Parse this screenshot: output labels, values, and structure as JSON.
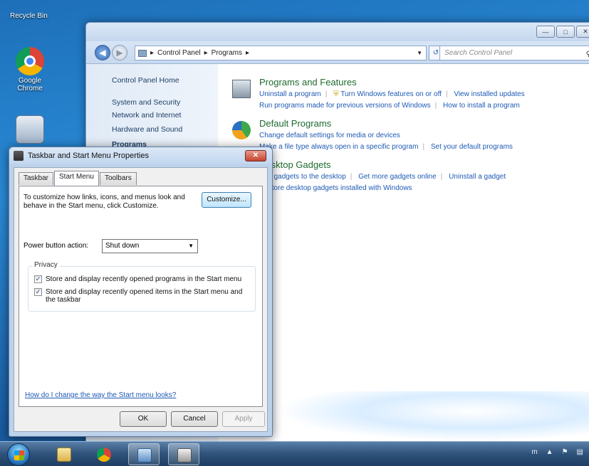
{
  "desktop": {
    "recycle_bin": "Recycle Bin",
    "chrome": "Google Chrome"
  },
  "control_panel": {
    "breadcrumb": [
      "Control Panel",
      "Programs"
    ],
    "search_placeholder": "Search Control Panel",
    "sidebar": [
      "Control Panel Home",
      "System and Security",
      "Network and Internet",
      "Hardware and Sound",
      "Programs"
    ],
    "categories": [
      {
        "title": "Programs and Features",
        "row1": [
          "Uninstall a program",
          "Turn Windows features on or off",
          "View installed updates"
        ],
        "row2": [
          "Run programs made for previous versions of Windows",
          "How to install a program"
        ]
      },
      {
        "title": "Default Programs",
        "row1": [
          "Change default settings for media or devices"
        ],
        "row2": [
          "Make a file type always open in a specific program",
          "Set your default programs"
        ]
      },
      {
        "title": "Desktop Gadgets",
        "row1": [
          "Add gadgets to the desktop",
          "Get more gadgets online",
          "Uninstall a gadget"
        ],
        "row2": [
          "Restore desktop gadgets installed with Windows"
        ]
      }
    ]
  },
  "dialog": {
    "title": "Taskbar and Start Menu Properties",
    "tabs": [
      "Taskbar",
      "Start Menu",
      "Toolbars"
    ],
    "active_tab": "Start Menu",
    "description": "To customize how links, icons, and menus look and behave in the Start menu, click Customize.",
    "customize_label": "Customize...",
    "power_label": "Power button action:",
    "power_value": "Shut down",
    "privacy_label": "Privacy",
    "privacy_options": [
      {
        "label": "Store and display recently opened programs in the Start menu",
        "checked": true
      },
      {
        "label": "Store and display recently opened items in the Start menu and the taskbar",
        "checked": true
      }
    ],
    "help_link": "How do I change the way the Start menu looks?",
    "ok_label": "OK",
    "cancel_label": "Cancel",
    "apply_label": "Apply"
  },
  "taskbar": {
    "pinned": [
      "start-orb",
      "explorer-icon",
      "chrome-icon",
      "control-panel-icon",
      "properties-icon"
    ],
    "tray_language": "m"
  }
}
